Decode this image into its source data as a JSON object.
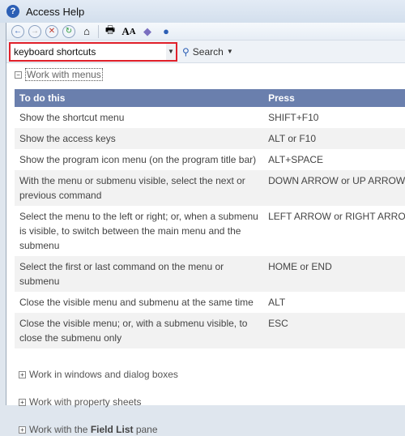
{
  "window": {
    "title": "Access Help"
  },
  "toolbar": {
    "icons": [
      "back-icon",
      "forward-icon",
      "stop-icon",
      "refresh-icon",
      "home-icon",
      "print-icon",
      "font-size-icon",
      "book-icon",
      "pin-icon"
    ]
  },
  "search": {
    "value": "keyboard shortcuts",
    "button": "Search"
  },
  "expanded_section": {
    "label": "Work with menus"
  },
  "table": {
    "headers": [
      "To do this",
      "Press"
    ],
    "rows": [
      [
        "Show the shortcut menu",
        "SHIFT+F10"
      ],
      [
        "Show the access keys",
        "ALT or F10"
      ],
      [
        "Show the program icon menu (on the program title bar)",
        "ALT+SPACE"
      ],
      [
        "With the menu or submenu visible, select the next or previous command",
        "DOWN ARROW or UP ARROW"
      ],
      [
        "Select the menu to the left or right; or, when a submenu is visible, to switch between the main menu and the submenu",
        "LEFT ARROW or RIGHT ARROW"
      ],
      [
        "Select the first or last command on the menu or submenu",
        "HOME or END"
      ],
      [
        "Close the visible menu and submenu at the same time",
        "ALT"
      ],
      [
        "Close the visible menu; or, with a submenu visible, to close the submenu only",
        "ESC"
      ]
    ]
  },
  "collapsed_sections": [
    {
      "pre": "Work in windows and dialog boxes",
      "bold": "",
      "post": ""
    },
    {
      "pre": "Work with property sheets",
      "bold": "",
      "post": ""
    },
    {
      "pre": "Work with the ",
      "bold": "Field List",
      "post": " pane"
    }
  ]
}
